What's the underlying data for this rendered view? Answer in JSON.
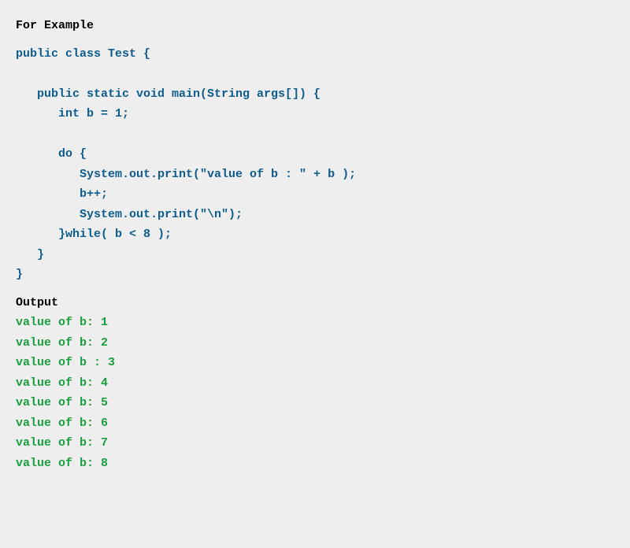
{
  "heading": "For Example",
  "code": "public class Test {\n\n   public static void main(String args[]) {\n      int b = 1;\n\n      do {\n         System.out.print(\"value of b : \" + b );\n         b++;\n         System.out.print(\"\\n\");\n      }while( b < 8 );\n   }\n}",
  "outputHeading": "Output",
  "output": "value of b: 1\nvalue of b: 2\nvalue of b : 3\nvalue of b: 4\nvalue of b: 5\nvalue of b: 6\nvalue of b: 7\nvalue of b: 8"
}
